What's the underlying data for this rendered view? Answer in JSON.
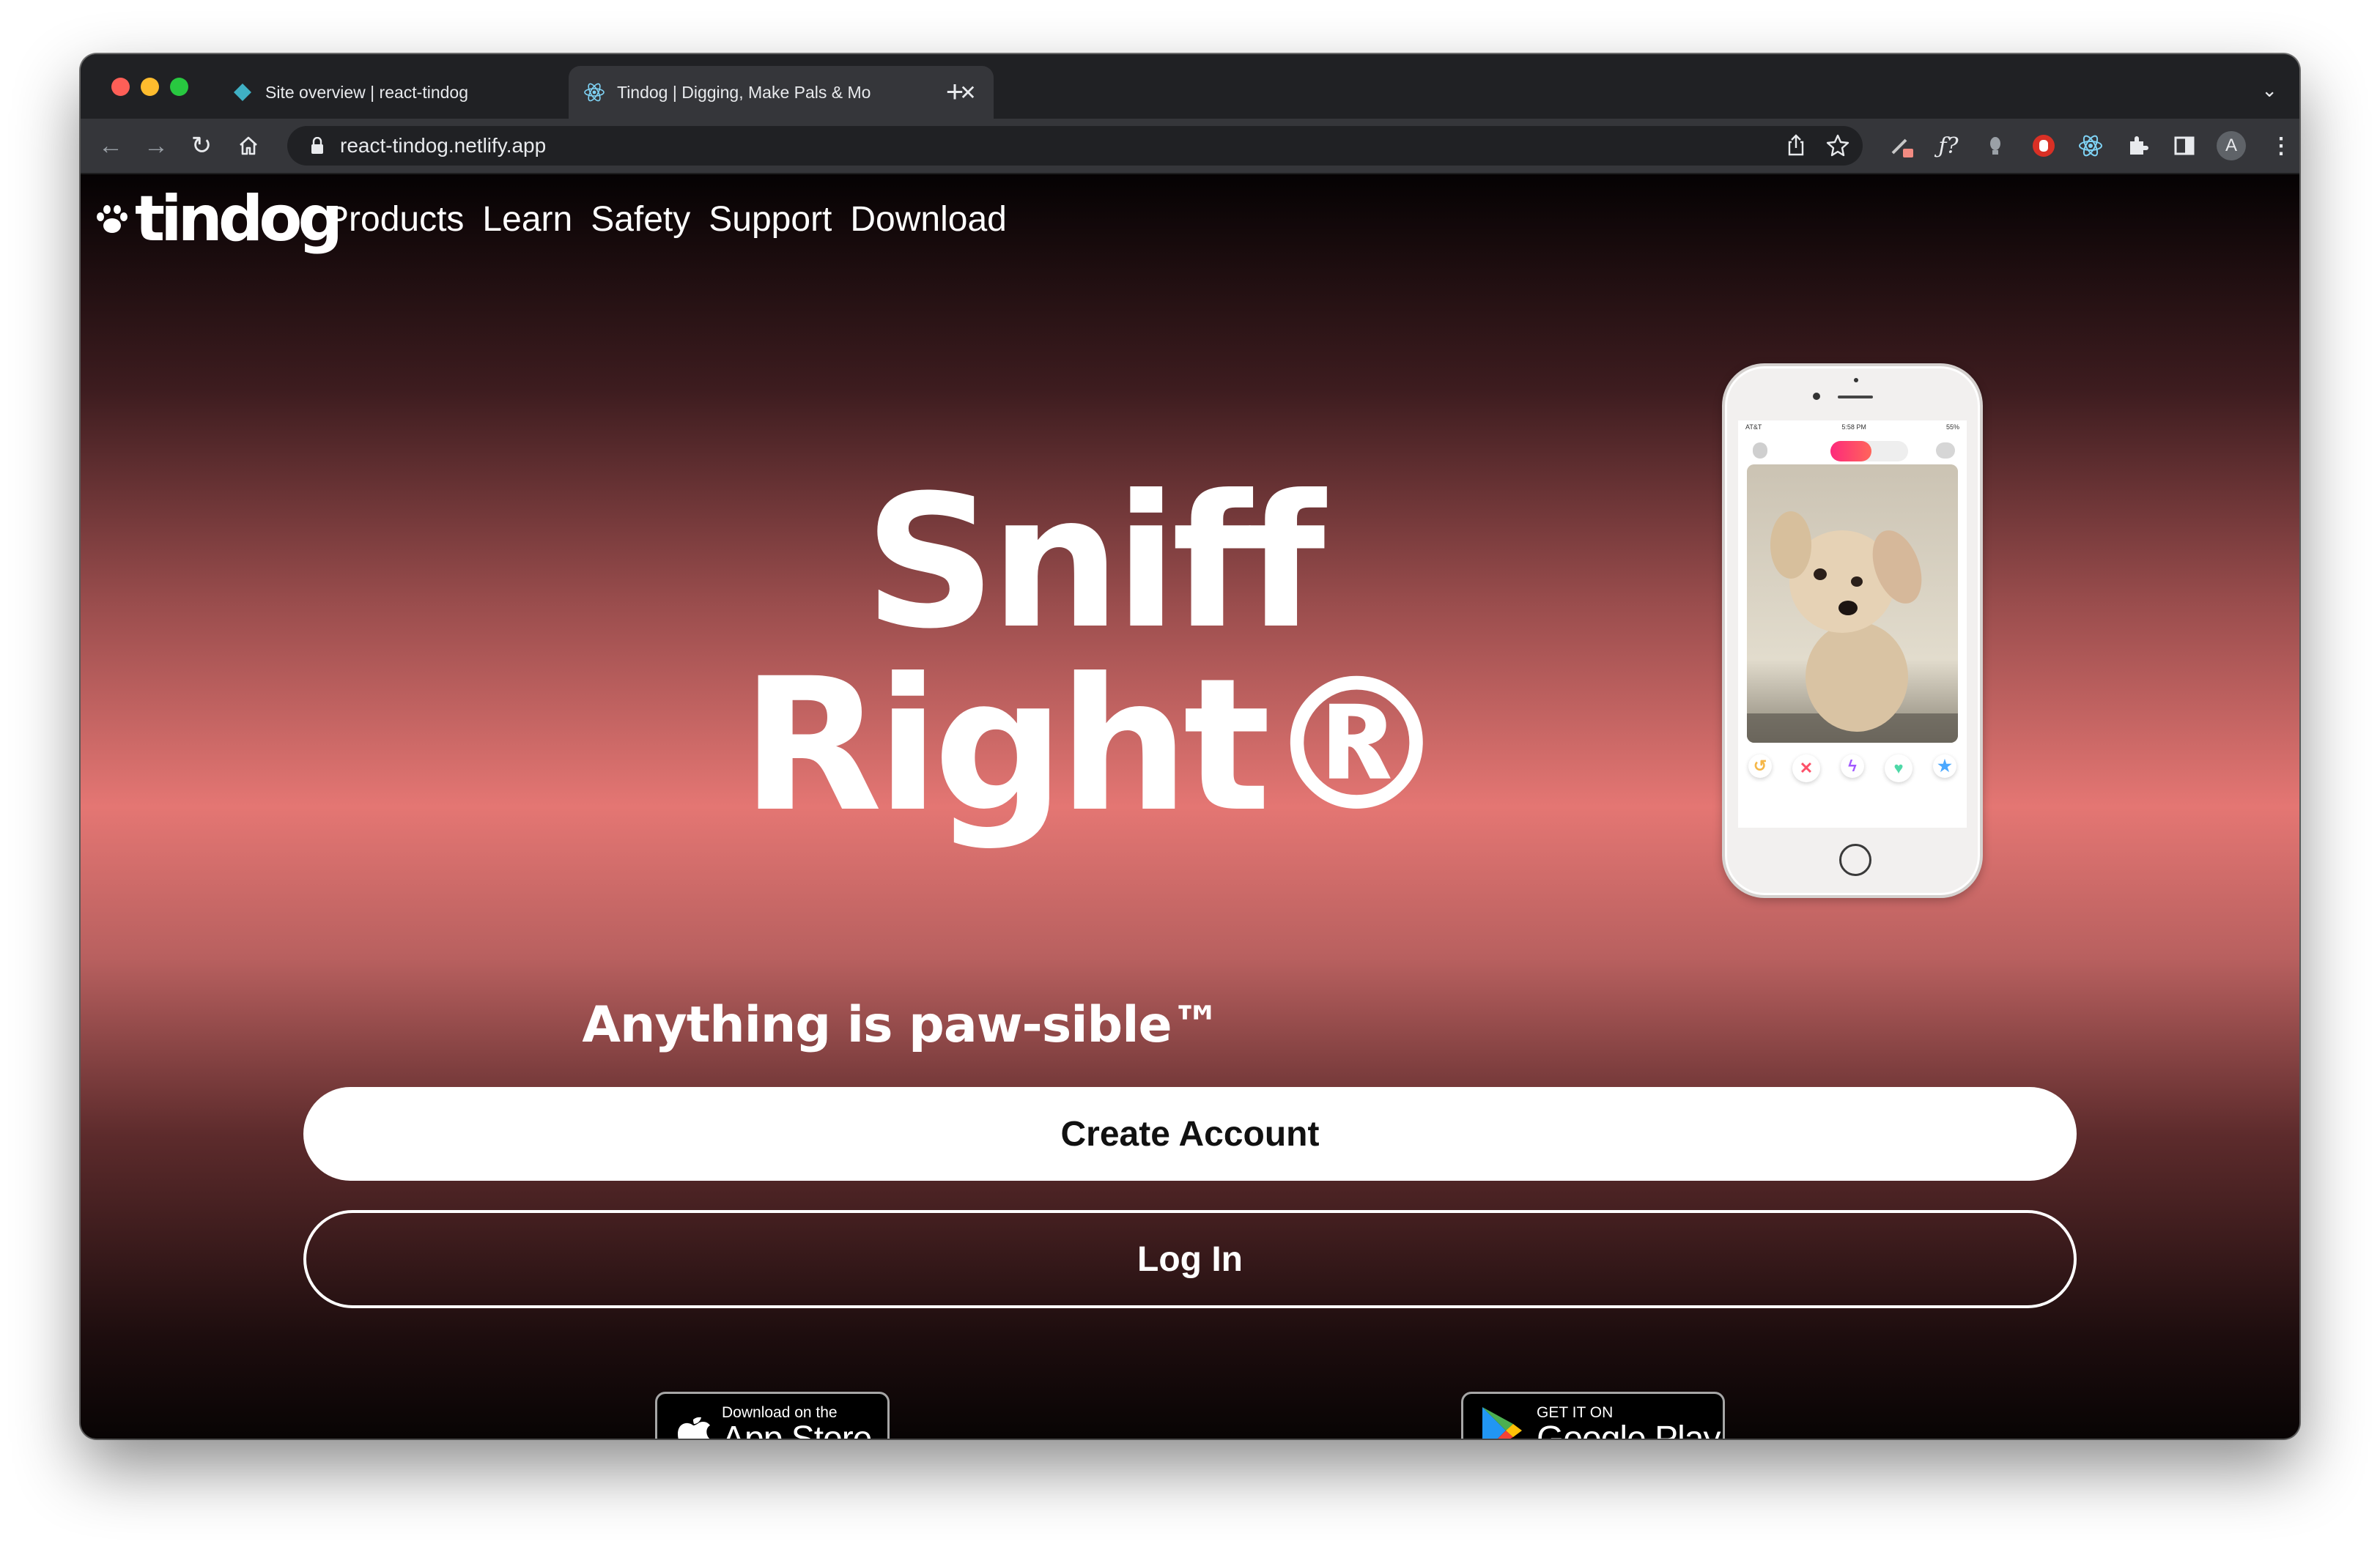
{
  "browser": {
    "tabs": [
      {
        "title": "Site overview | react-tindog",
        "active": false
      },
      {
        "title": "Tindog | Digging, Make Pals & Mo",
        "active": true
      }
    ],
    "url": "react-tindog.netlify.app",
    "profile_initial": "A"
  },
  "site": {
    "brand": "tindog",
    "nav": [
      "Products",
      "Learn",
      "Safety",
      "Support",
      "Download"
    ],
    "hero_title": "Sniff Right®",
    "tagline": "Anything is paw-sible™",
    "create_account": "Create Account",
    "log_in": "Log In",
    "app_store": {
      "small": "Download on the",
      "big": "App Store"
    },
    "google_play": {
      "small": "GET IT ON",
      "big": "Google Play"
    },
    "phone": {
      "carrier": "AT&T",
      "time": "5:58 PM",
      "battery": "55%"
    }
  },
  "colors": {
    "accent_pink": "#e47673",
    "tab_bar": "#202124",
    "toolbar": "#35363a"
  }
}
